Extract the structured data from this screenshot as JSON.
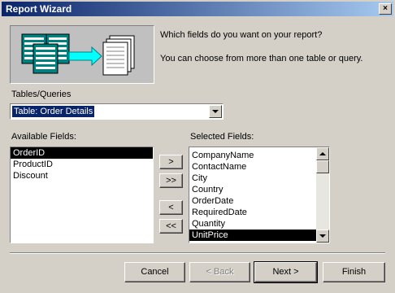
{
  "window": {
    "title": "Report Wizard",
    "close_glyph": "×"
  },
  "intro": {
    "question": "Which fields do you want on your report?",
    "hint": "You can choose from more than one table or query."
  },
  "tables": {
    "label": "Tables/Queries",
    "selected": "Table: Order Details"
  },
  "available": {
    "label": "Available Fields:",
    "items": [
      "OrderID",
      "ProductID",
      "Discount"
    ]
  },
  "selected": {
    "label": "Selected Fields:",
    "items": [
      "CompanyName",
      "ContactName",
      "City",
      "Country",
      "OrderDate",
      "RequiredDate",
      "Quantity",
      "UnitPrice"
    ]
  },
  "move_buttons": {
    "add": ">",
    "add_all": ">>",
    "remove": "<",
    "remove_all": "<<"
  },
  "footer": {
    "cancel": "Cancel",
    "back": "< Back",
    "next": "Next >",
    "finish": "Finish"
  },
  "colors": {
    "title_start": "#0a246a",
    "title_end": "#a6caf0",
    "face": "#d4d0c8",
    "selection": "#0a246a"
  }
}
